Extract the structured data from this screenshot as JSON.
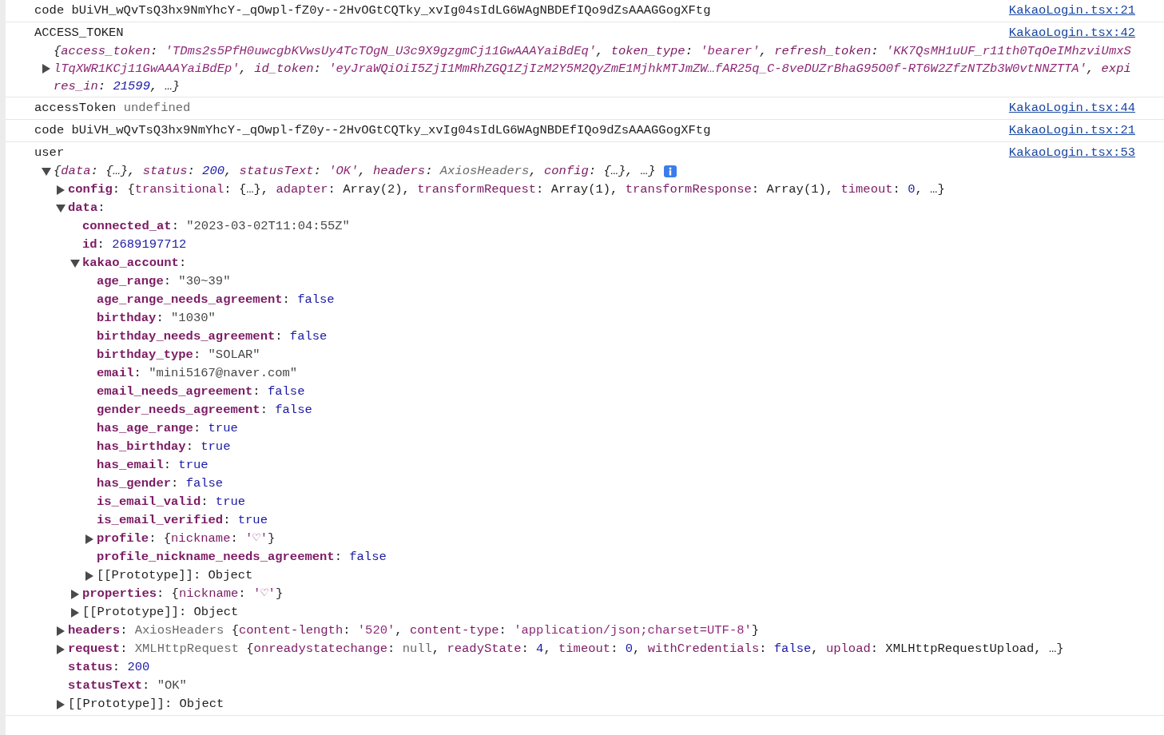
{
  "messages": [
    {
      "parts": [
        {
          "kind": "p",
          "text": "code bUiVH_wQvTsQ3hx9NmYhcY-_qOwpl-fZ0y--2HvOGtCQTky_xvIg04sIdLG6WAgNBDEfIQo9dZsAAAGGogXFtg"
        }
      ],
      "source": "KakaoLogin.tsx:21"
    },
    {
      "parts": [
        {
          "kind": "p",
          "text": "ACCESS_TOKEN"
        }
      ],
      "source": "KakaoLogin.tsx:42",
      "object": {
        "expanded": false,
        "tokens": [
          {
            "kind": "p",
            "text": "{"
          },
          {
            "kind": "pkey",
            "text": "access_token"
          },
          {
            "kind": "p",
            "text": ": "
          },
          {
            "kind": "pstr",
            "text": "'TDms2s5PfH0uwcgbKVwsUy4TcTOgN_U3c9X9gzgmCj11GwAAAYaiBdEq'"
          },
          {
            "kind": "p",
            "text": ", "
          },
          {
            "kind": "pkey",
            "text": "token_type"
          },
          {
            "kind": "p",
            "text": ": "
          },
          {
            "kind": "pstr",
            "text": "'bearer'"
          },
          {
            "kind": "p",
            "text": ", "
          },
          {
            "kind": "pkey",
            "text": "refresh_token"
          },
          {
            "kind": "p",
            "text": ": "
          },
          {
            "kind": "pstr",
            "text": "'KK7QsMH1uUF_r11th0TqOeIMhzviUmxSlTqXWR1KCj11GwAAAYaiBdEp'"
          },
          {
            "kind": "p",
            "text": ", "
          },
          {
            "kind": "pkey",
            "text": "id_token"
          },
          {
            "kind": "p",
            "text": ": "
          },
          {
            "kind": "pstr",
            "text": "'eyJraWQiOiI5ZjI1MmRhZGQ1ZjIzM2Y5M2QyZmE1MjhkMTJmZW…fAR25q_C-8veDUZrBhaG95O0f-RT6W2ZfzNTZb3W0vtNNZTTA'"
          },
          {
            "kind": "p",
            "text": ", "
          },
          {
            "kind": "pkey",
            "text": "expires_in"
          },
          {
            "kind": "p",
            "text": ": "
          },
          {
            "kind": "lit",
            "text": "21599"
          },
          {
            "kind": "p",
            "text": ", …}"
          }
        ]
      }
    },
    {
      "parts": [
        {
          "kind": "p",
          "text": "accessToken "
        },
        {
          "kind": "gray",
          "text": "undefined"
        }
      ],
      "source": "KakaoLogin.tsx:44"
    },
    {
      "parts": [
        {
          "kind": "p",
          "text": "code bUiVH_wQvTsQ3hx9NmYhcY-_qOwpl-fZ0y--2HvOGtCQTky_xvIg04sIdLG6WAgNBDEfIQo9dZsAAAGGogXFtg"
        }
      ],
      "source": "KakaoLogin.tsx:21"
    },
    {
      "parts": [
        {
          "kind": "p",
          "text": "user"
        }
      ],
      "source": "KakaoLogin.tsx:53",
      "object": {
        "expanded": true,
        "tokens": [
          {
            "kind": "p",
            "text": "{"
          },
          {
            "kind": "pkey",
            "text": "data"
          },
          {
            "kind": "p",
            "text": ": {…}, "
          },
          {
            "kind": "pkey",
            "text": "status"
          },
          {
            "kind": "p",
            "text": ": "
          },
          {
            "kind": "lit",
            "text": "200"
          },
          {
            "kind": "p",
            "text": ", "
          },
          {
            "kind": "pkey",
            "text": "statusText"
          },
          {
            "kind": "p",
            "text": ": "
          },
          {
            "kind": "pstr",
            "text": "'OK'"
          },
          {
            "kind": "p",
            "text": ", "
          },
          {
            "kind": "pkey",
            "text": "headers"
          },
          {
            "kind": "p",
            "text": ": "
          },
          {
            "kind": "gray",
            "text": "AxiosHeaders"
          },
          {
            "kind": "p",
            "text": ", "
          },
          {
            "kind": "pkey",
            "text": "config"
          },
          {
            "kind": "p",
            "text": ": {…}, …}"
          }
        ],
        "children": [
          {
            "expanded": false,
            "tokens": [
              {
                "kind": "key",
                "text": "config"
              },
              {
                "kind": "p",
                "text": ": {"
              },
              {
                "kind": "pkey",
                "text": "transitional"
              },
              {
                "kind": "p",
                "text": ": {…}, "
              },
              {
                "kind": "pkey",
                "text": "adapter"
              },
              {
                "kind": "p",
                "text": ": Array(2), "
              },
              {
                "kind": "pkey",
                "text": "transformRequest"
              },
              {
                "kind": "p",
                "text": ": Array(1), "
              },
              {
                "kind": "pkey",
                "text": "transformResponse"
              },
              {
                "kind": "p",
                "text": ": Array(1), "
              },
              {
                "kind": "pkey",
                "text": "timeout"
              },
              {
                "kind": "p",
                "text": ": "
              },
              {
                "kind": "lit",
                "text": "0"
              },
              {
                "kind": "p",
                "text": ", …}"
              }
            ]
          },
          {
            "expanded": true,
            "tokens": [
              {
                "kind": "key",
                "text": "data"
              },
              {
                "kind": "p",
                "text": ":"
              }
            ],
            "children": [
              {
                "tokens": [
                  {
                    "kind": "key",
                    "text": "connected_at"
                  },
                  {
                    "kind": "p",
                    "text": ": "
                  },
                  {
                    "kind": "str",
                    "text": "\"2023-03-02T11:04:55Z\""
                  }
                ]
              },
              {
                "tokens": [
                  {
                    "kind": "key",
                    "text": "id"
                  },
                  {
                    "kind": "p",
                    "text": ": "
                  },
                  {
                    "kind": "lit",
                    "text": "2689197712"
                  }
                ]
              },
              {
                "expanded": true,
                "tokens": [
                  {
                    "kind": "key",
                    "text": "kakao_account"
                  },
                  {
                    "kind": "p",
                    "text": ":"
                  }
                ],
                "children": [
                  {
                    "tokens": [
                      {
                        "kind": "key",
                        "text": "age_range"
                      },
                      {
                        "kind": "p",
                        "text": ": "
                      },
                      {
                        "kind": "str",
                        "text": "\"30~39\""
                      }
                    ]
                  },
                  {
                    "tokens": [
                      {
                        "kind": "key",
                        "text": "age_range_needs_agreement"
                      },
                      {
                        "kind": "p",
                        "text": ": "
                      },
                      {
                        "kind": "lit",
                        "text": "false"
                      }
                    ]
                  },
                  {
                    "tokens": [
                      {
                        "kind": "key",
                        "text": "birthday"
                      },
                      {
                        "kind": "p",
                        "text": ": "
                      },
                      {
                        "kind": "str",
                        "text": "\"1030\""
                      }
                    ]
                  },
                  {
                    "tokens": [
                      {
                        "kind": "key",
                        "text": "birthday_needs_agreement"
                      },
                      {
                        "kind": "p",
                        "text": ": "
                      },
                      {
                        "kind": "lit",
                        "text": "false"
                      }
                    ]
                  },
                  {
                    "tokens": [
                      {
                        "kind": "key",
                        "text": "birthday_type"
                      },
                      {
                        "kind": "p",
                        "text": ": "
                      },
                      {
                        "kind": "str",
                        "text": "\"SOLAR\""
                      }
                    ]
                  },
                  {
                    "tokens": [
                      {
                        "kind": "key",
                        "text": "email"
                      },
                      {
                        "kind": "p",
                        "text": ": "
                      },
                      {
                        "kind": "str",
                        "text": "\"mini5167@naver.com\""
                      }
                    ]
                  },
                  {
                    "tokens": [
                      {
                        "kind": "key",
                        "text": "email_needs_agreement"
                      },
                      {
                        "kind": "p",
                        "text": ": "
                      },
                      {
                        "kind": "lit",
                        "text": "false"
                      }
                    ]
                  },
                  {
                    "tokens": [
                      {
                        "kind": "key",
                        "text": "gender_needs_agreement"
                      },
                      {
                        "kind": "p",
                        "text": ": "
                      },
                      {
                        "kind": "lit",
                        "text": "false"
                      }
                    ]
                  },
                  {
                    "tokens": [
                      {
                        "kind": "key",
                        "text": "has_age_range"
                      },
                      {
                        "kind": "p",
                        "text": ": "
                      },
                      {
                        "kind": "lit",
                        "text": "true"
                      }
                    ]
                  },
                  {
                    "tokens": [
                      {
                        "kind": "key",
                        "text": "has_birthday"
                      },
                      {
                        "kind": "p",
                        "text": ": "
                      },
                      {
                        "kind": "lit",
                        "text": "true"
                      }
                    ]
                  },
                  {
                    "tokens": [
                      {
                        "kind": "key",
                        "text": "has_email"
                      },
                      {
                        "kind": "p",
                        "text": ": "
                      },
                      {
                        "kind": "lit",
                        "text": "true"
                      }
                    ]
                  },
                  {
                    "tokens": [
                      {
                        "kind": "key",
                        "text": "has_gender"
                      },
                      {
                        "kind": "p",
                        "text": ": "
                      },
                      {
                        "kind": "lit",
                        "text": "false"
                      }
                    ]
                  },
                  {
                    "tokens": [
                      {
                        "kind": "key",
                        "text": "is_email_valid"
                      },
                      {
                        "kind": "p",
                        "text": ": "
                      },
                      {
                        "kind": "lit",
                        "text": "true"
                      }
                    ]
                  },
                  {
                    "tokens": [
                      {
                        "kind": "key",
                        "text": "is_email_verified"
                      },
                      {
                        "kind": "p",
                        "text": ": "
                      },
                      {
                        "kind": "lit",
                        "text": "true"
                      }
                    ]
                  },
                  {
                    "expanded": false,
                    "tokens": [
                      {
                        "kind": "key",
                        "text": "profile"
                      },
                      {
                        "kind": "p",
                        "text": ": {"
                      },
                      {
                        "kind": "pkey",
                        "text": "nickname"
                      },
                      {
                        "kind": "p",
                        "text": ": "
                      },
                      {
                        "kind": "pstr",
                        "text": "'♡'"
                      },
                      {
                        "kind": "p",
                        "text": "}"
                      }
                    ]
                  },
                  {
                    "tokens": [
                      {
                        "kind": "key",
                        "text": "profile_nickname_needs_agreement"
                      },
                      {
                        "kind": "p",
                        "text": ": "
                      },
                      {
                        "kind": "lit",
                        "text": "false"
                      }
                    ]
                  },
                  {
                    "expanded": false,
                    "tokens": [
                      {
                        "kind": "ikey",
                        "text": "[[Prototype]]"
                      },
                      {
                        "kind": "p",
                        "text": ": Object"
                      }
                    ]
                  }
                ]
              },
              {
                "expanded": false,
                "tokens": [
                  {
                    "kind": "key",
                    "text": "properties"
                  },
                  {
                    "kind": "p",
                    "text": ": {"
                  },
                  {
                    "kind": "pkey",
                    "text": "nickname"
                  },
                  {
                    "kind": "p",
                    "text": ": "
                  },
                  {
                    "kind": "pstr",
                    "text": "'♡'"
                  },
                  {
                    "kind": "p",
                    "text": "}"
                  }
                ]
              },
              {
                "expanded": false,
                "tokens": [
                  {
                    "kind": "ikey",
                    "text": "[[Prototype]]"
                  },
                  {
                    "kind": "p",
                    "text": ": Object"
                  }
                ]
              }
            ]
          },
          {
            "expanded": false,
            "tokens": [
              {
                "kind": "key",
                "text": "headers"
              },
              {
                "kind": "p",
                "text": ": "
              },
              {
                "kind": "gray",
                "text": "AxiosHeaders "
              },
              {
                "kind": "p",
                "text": "{"
              },
              {
                "kind": "pkey",
                "text": "content-length"
              },
              {
                "kind": "p",
                "text": ": "
              },
              {
                "kind": "pstr",
                "text": "'520'"
              },
              {
                "kind": "p",
                "text": ", "
              },
              {
                "kind": "pkey",
                "text": "content-type"
              },
              {
                "kind": "p",
                "text": ": "
              },
              {
                "kind": "pstr",
                "text": "'application/json;charset=UTF-8'"
              },
              {
                "kind": "p",
                "text": "}"
              }
            ]
          },
          {
            "expanded": false,
            "tokens": [
              {
                "kind": "key",
                "text": "request"
              },
              {
                "kind": "p",
                "text": ": "
              },
              {
                "kind": "gray",
                "text": "XMLHttpRequest "
              },
              {
                "kind": "p",
                "text": "{"
              },
              {
                "kind": "pkey",
                "text": "onreadystatechange"
              },
              {
                "kind": "p",
                "text": ": "
              },
              {
                "kind": "gray",
                "text": "null"
              },
              {
                "kind": "p",
                "text": ", "
              },
              {
                "kind": "pkey",
                "text": "readyState"
              },
              {
                "kind": "p",
                "text": ": "
              },
              {
                "kind": "lit",
                "text": "4"
              },
              {
                "kind": "p",
                "text": ", "
              },
              {
                "kind": "pkey",
                "text": "timeout"
              },
              {
                "kind": "p",
                "text": ": "
              },
              {
                "kind": "lit",
                "text": "0"
              },
              {
                "kind": "p",
                "text": ", "
              },
              {
                "kind": "pkey",
                "text": "withCredentials"
              },
              {
                "kind": "p",
                "text": ": "
              },
              {
                "kind": "lit",
                "text": "false"
              },
              {
                "kind": "p",
                "text": ", "
              },
              {
                "kind": "pkey",
                "text": "upload"
              },
              {
                "kind": "p",
                "text": ": XMLHttpRequestUpload, …}"
              }
            ]
          },
          {
            "tokens": [
              {
                "kind": "key",
                "text": "status"
              },
              {
                "kind": "p",
                "text": ": "
              },
              {
                "kind": "lit",
                "text": "200"
              }
            ]
          },
          {
            "tokens": [
              {
                "kind": "key",
                "text": "statusText"
              },
              {
                "kind": "p",
                "text": ": "
              },
              {
                "kind": "str",
                "text": "\"OK\""
              }
            ]
          },
          {
            "expanded": false,
            "tokens": [
              {
                "kind": "ikey",
                "text": "[[Prototype]]"
              },
              {
                "kind": "p",
                "text": ": Object"
              }
            ]
          }
        ]
      }
    }
  ]
}
